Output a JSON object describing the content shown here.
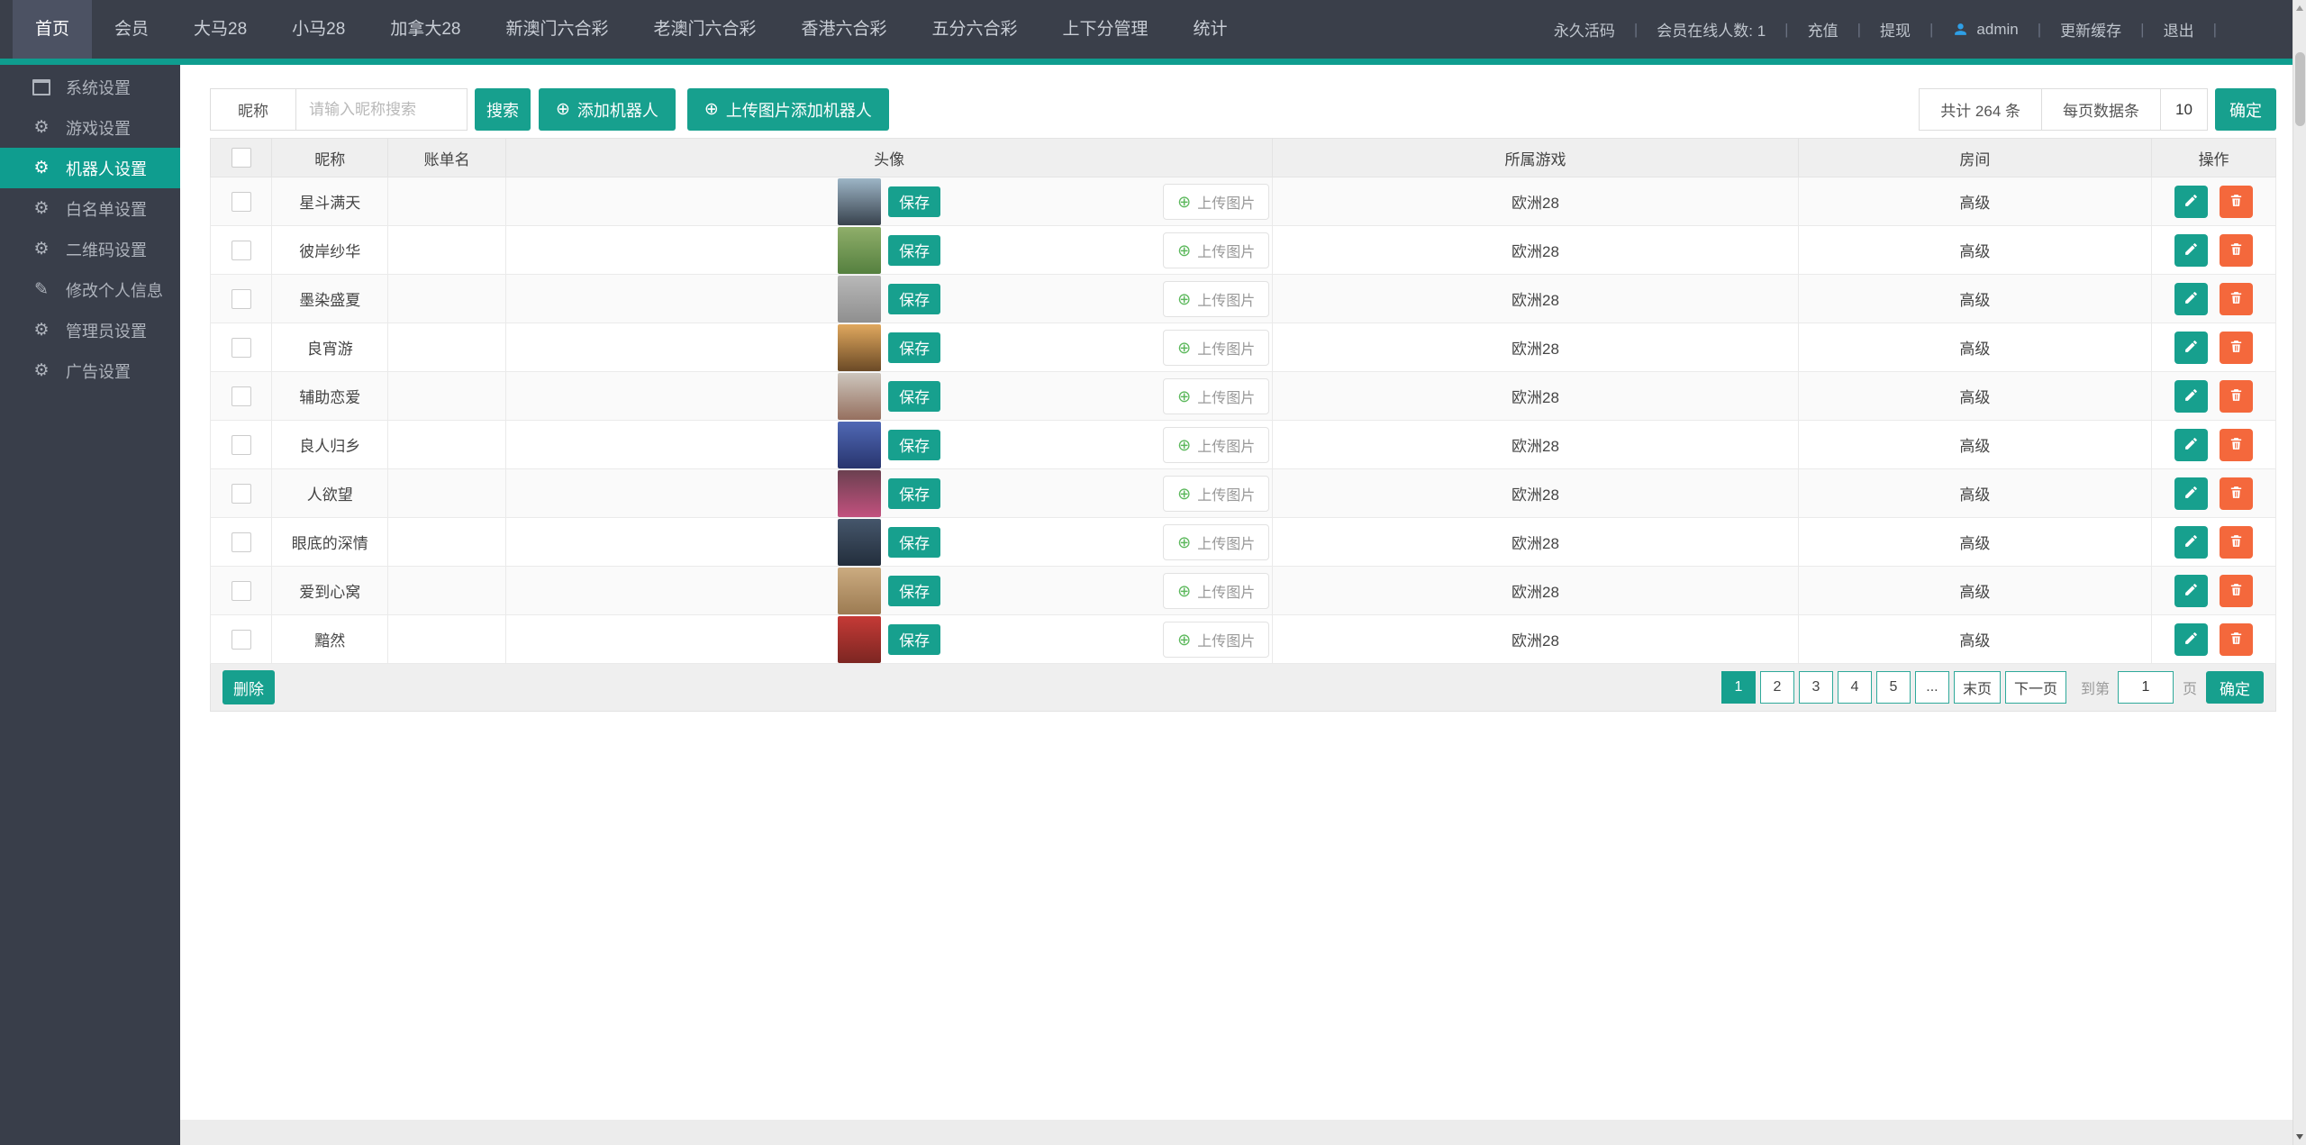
{
  "topbar": {
    "tabs": [
      {
        "label": "首页",
        "active": true
      },
      {
        "label": "会员"
      },
      {
        "label": "大马28"
      },
      {
        "label": "小马28"
      },
      {
        "label": "加拿大28"
      },
      {
        "label": "新澳门六合彩"
      },
      {
        "label": "老澳门六合彩"
      },
      {
        "label": "香港六合彩"
      },
      {
        "label": "五分六合彩"
      },
      {
        "label": "上下分管理"
      },
      {
        "label": "统计"
      }
    ],
    "meta": [
      {
        "label": "永久活码"
      },
      {
        "label": "会员在线人数: 1"
      },
      {
        "label": "充值"
      },
      {
        "label": "提现"
      },
      {
        "label": "admin",
        "icon": "user-icon"
      },
      {
        "label": "更新缓存"
      },
      {
        "label": "退出"
      }
    ]
  },
  "sidebar": {
    "items": [
      {
        "label": "系统设置",
        "icon": "window-icon",
        "glyph": ""
      },
      {
        "label": "游戏设置",
        "icon": "gear-icon",
        "glyph": "⚙"
      },
      {
        "label": "机器人设置",
        "icon": "gear-icon",
        "glyph": "⚙",
        "active": true
      },
      {
        "label": "白名单设置",
        "icon": "gear-icon",
        "glyph": "⚙"
      },
      {
        "label": "二维码设置",
        "icon": "gear-icon",
        "glyph": "⚙"
      },
      {
        "label": "修改个人信息",
        "icon": "pencil-icon",
        "glyph": "✎"
      },
      {
        "label": "管理员设置",
        "icon": "gear-icon",
        "glyph": "⚙"
      },
      {
        "label": "广告设置",
        "icon": "gear-icon",
        "glyph": "⚙"
      }
    ]
  },
  "filter": {
    "name_label": "昵称",
    "search_placeholder": "请输入昵称搜索",
    "search_button": "搜索",
    "plus_glyph": "⊕",
    "add_robot_button": "添加机器人",
    "upload_add_button": "上传图片添加机器人",
    "total_count": "共计 264 条",
    "per_page_label": "每页数据条",
    "per_page_value": "10",
    "confirm_button": "确定"
  },
  "table": {
    "headers": [
      "昵称",
      "账单名",
      "头像",
      "所属游戏",
      "房间",
      "操作"
    ],
    "save_label": "保存",
    "upload_label": "上传图片",
    "rows": [
      {
        "name": "星斗满天",
        "account": "",
        "game": "欧洲28",
        "room": "高级",
        "avatar": {
          "top": "#9db5c6",
          "bottom": "#38424d"
        }
      },
      {
        "name": "彼岸纱华",
        "account": "",
        "game": "欧洲28",
        "room": "高级",
        "avatar": {
          "top": "#8fae6a",
          "bottom": "#55803f"
        }
      },
      {
        "name": "墨染盛夏",
        "account": "",
        "game": "欧洲28",
        "room": "高级",
        "avatar": {
          "top": "#b8b8b8",
          "bottom": "#8f8f8f"
        }
      },
      {
        "name": "良宵游",
        "account": "",
        "game": "欧洲28",
        "room": "高级",
        "avatar": {
          "top": "#e0a85e",
          "bottom": "#6b4a26"
        }
      },
      {
        "name": "辅助恋爱",
        "account": "",
        "game": "欧洲28",
        "room": "高级",
        "avatar": {
          "top": "#cdc6bd",
          "bottom": "#96705f"
        }
      },
      {
        "name": "良人归乡",
        "account": "",
        "game": "欧洲28",
        "room": "高级",
        "avatar": {
          "top": "#5069b5",
          "bottom": "#28356e"
        }
      },
      {
        "name": "人欲望",
        "account": "",
        "game": "欧洲28",
        "room": "高级",
        "avatar": {
          "top": "#6b4050",
          "bottom": "#c2517e"
        }
      },
      {
        "name": "眼底的深情",
        "account": "",
        "game": "欧洲28",
        "room": "高级",
        "avatar": {
          "top": "#45566b",
          "bottom": "#232e3c"
        }
      },
      {
        "name": "爱到心窝",
        "account": "",
        "game": "欧洲28",
        "room": "高级",
        "avatar": {
          "top": "#cbab80",
          "bottom": "#9c7b52"
        }
      },
      {
        "name": "黯然",
        "account": "",
        "game": "欧洲28",
        "room": "高级",
        "avatar": {
          "top": "#c53a36",
          "bottom": "#7c2622"
        }
      }
    ]
  },
  "footer": {
    "delete_button": "删除",
    "pages": [
      {
        "label": "1",
        "active": true
      },
      {
        "label": "2"
      },
      {
        "label": "3"
      },
      {
        "label": "4"
      },
      {
        "label": "5"
      },
      {
        "label": "..."
      },
      {
        "label": "末页"
      },
      {
        "label": "下一页"
      }
    ],
    "goto_label": "到第",
    "goto_value": "1",
    "goto_unit": "页",
    "confirm_button": "确定"
  },
  "colors": {
    "accent": "#17a08e",
    "danger": "#f4683c",
    "topbar_bg": "#3a3f4a",
    "sidebar_bg": "#393e4a",
    "upload_plus_green": "#5cb85c",
    "admin_icon_blue": "#2e9fe6"
  }
}
